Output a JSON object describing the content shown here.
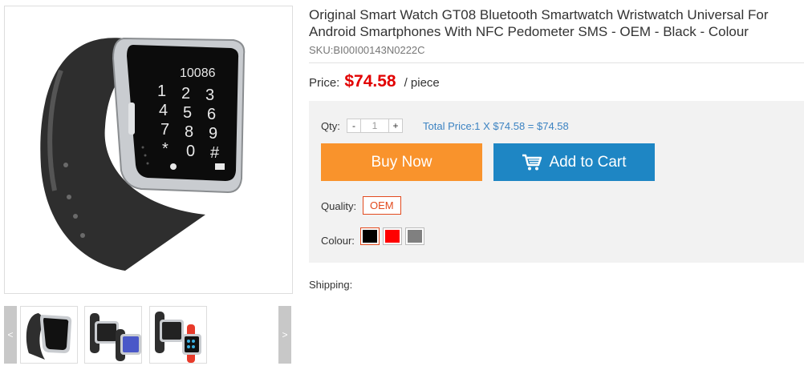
{
  "product": {
    "title": "Original Smart Watch GT08 Bluetooth Smartwatch Wristwatch Universal For Android Smartphones With NFC Pedometer SMS - OEM - Black - Colour",
    "sku": "SKU:BI00I00143N0222C"
  },
  "price": {
    "label": "Price:",
    "value": "$74.58",
    "unit": "/ piece"
  },
  "purchase": {
    "qty_label": "Qty:",
    "minus": "-",
    "plus": "+",
    "qty_value": "1",
    "total": "Total Price:1 X $74.58 = $74.58",
    "buy_now": "Buy Now",
    "add_to_cart": "Add to Cart"
  },
  "options": {
    "quality_label": "Quality:",
    "quality_selected": "OEM",
    "colour_label": "Colour:",
    "colours": [
      "#000000",
      "#ff0000",
      "#808080"
    ]
  },
  "shipping_label": "Shipping:",
  "gallery": {
    "prev": "<",
    "next": ">",
    "screen_digits": "10086"
  },
  "colors": {
    "price": "#e20000",
    "buy_button": "#f9932c",
    "cart_button": "#1e86c4",
    "total_text": "#3c83c2",
    "accent_border": "#e24a1e"
  }
}
